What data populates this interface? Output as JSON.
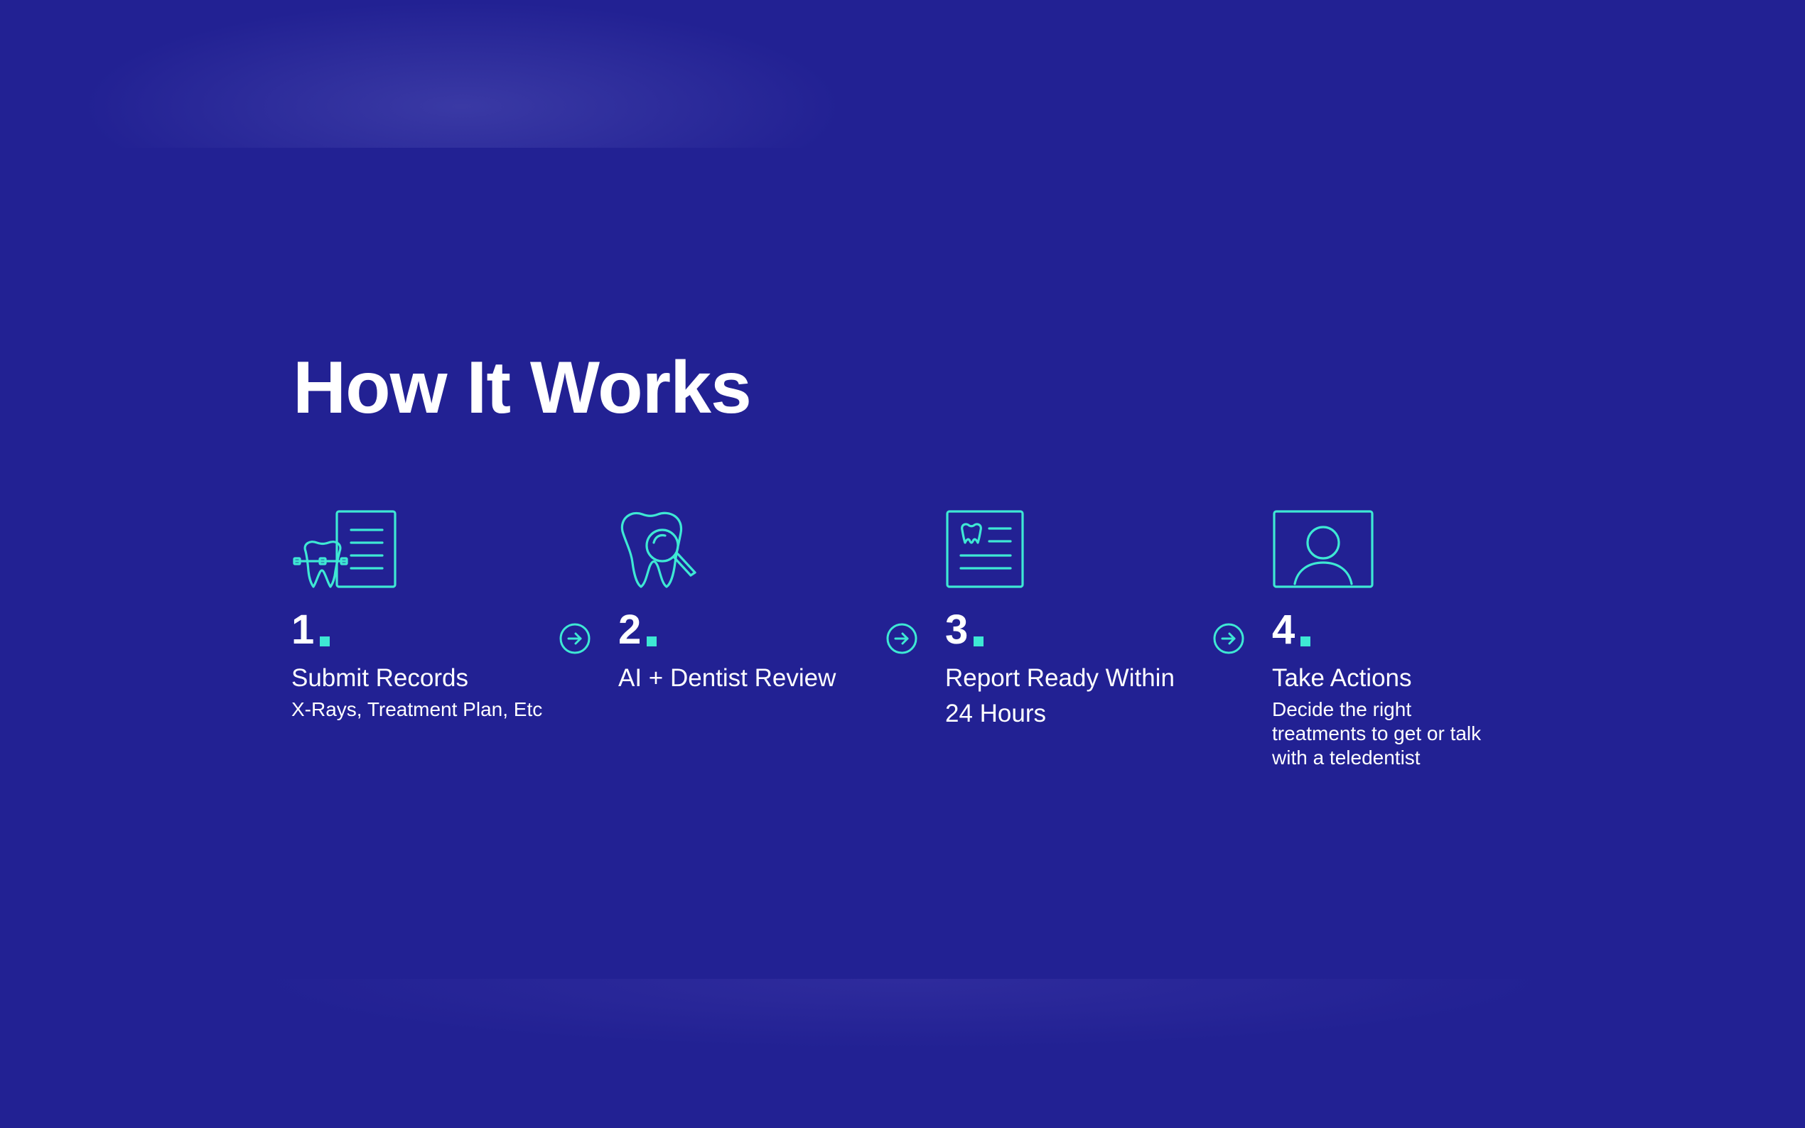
{
  "page": {
    "title": "How It Works"
  },
  "colors": {
    "background": "#222193",
    "accent": "#3ee8d4",
    "text": "#ffffff"
  },
  "steps": [
    {
      "number": "1",
      "title": "Submit Records",
      "description": "X-Rays, Treatment Plan, Etc",
      "icon": "tooth-braces-document-icon"
    },
    {
      "number": "2",
      "title": "AI + Dentist Review",
      "description": "",
      "icon": "tooth-magnifier-icon"
    },
    {
      "number": "3",
      "title": "Report Ready Within 24 Hours",
      "description": "",
      "icon": "dental-report-icon"
    },
    {
      "number": "4",
      "title": "Take Actions",
      "description": "Decide the right treatments to get or talk with a teledentist",
      "icon": "user-profile-screen-icon"
    }
  ],
  "connector_icon": "arrow-right-circle-icon"
}
